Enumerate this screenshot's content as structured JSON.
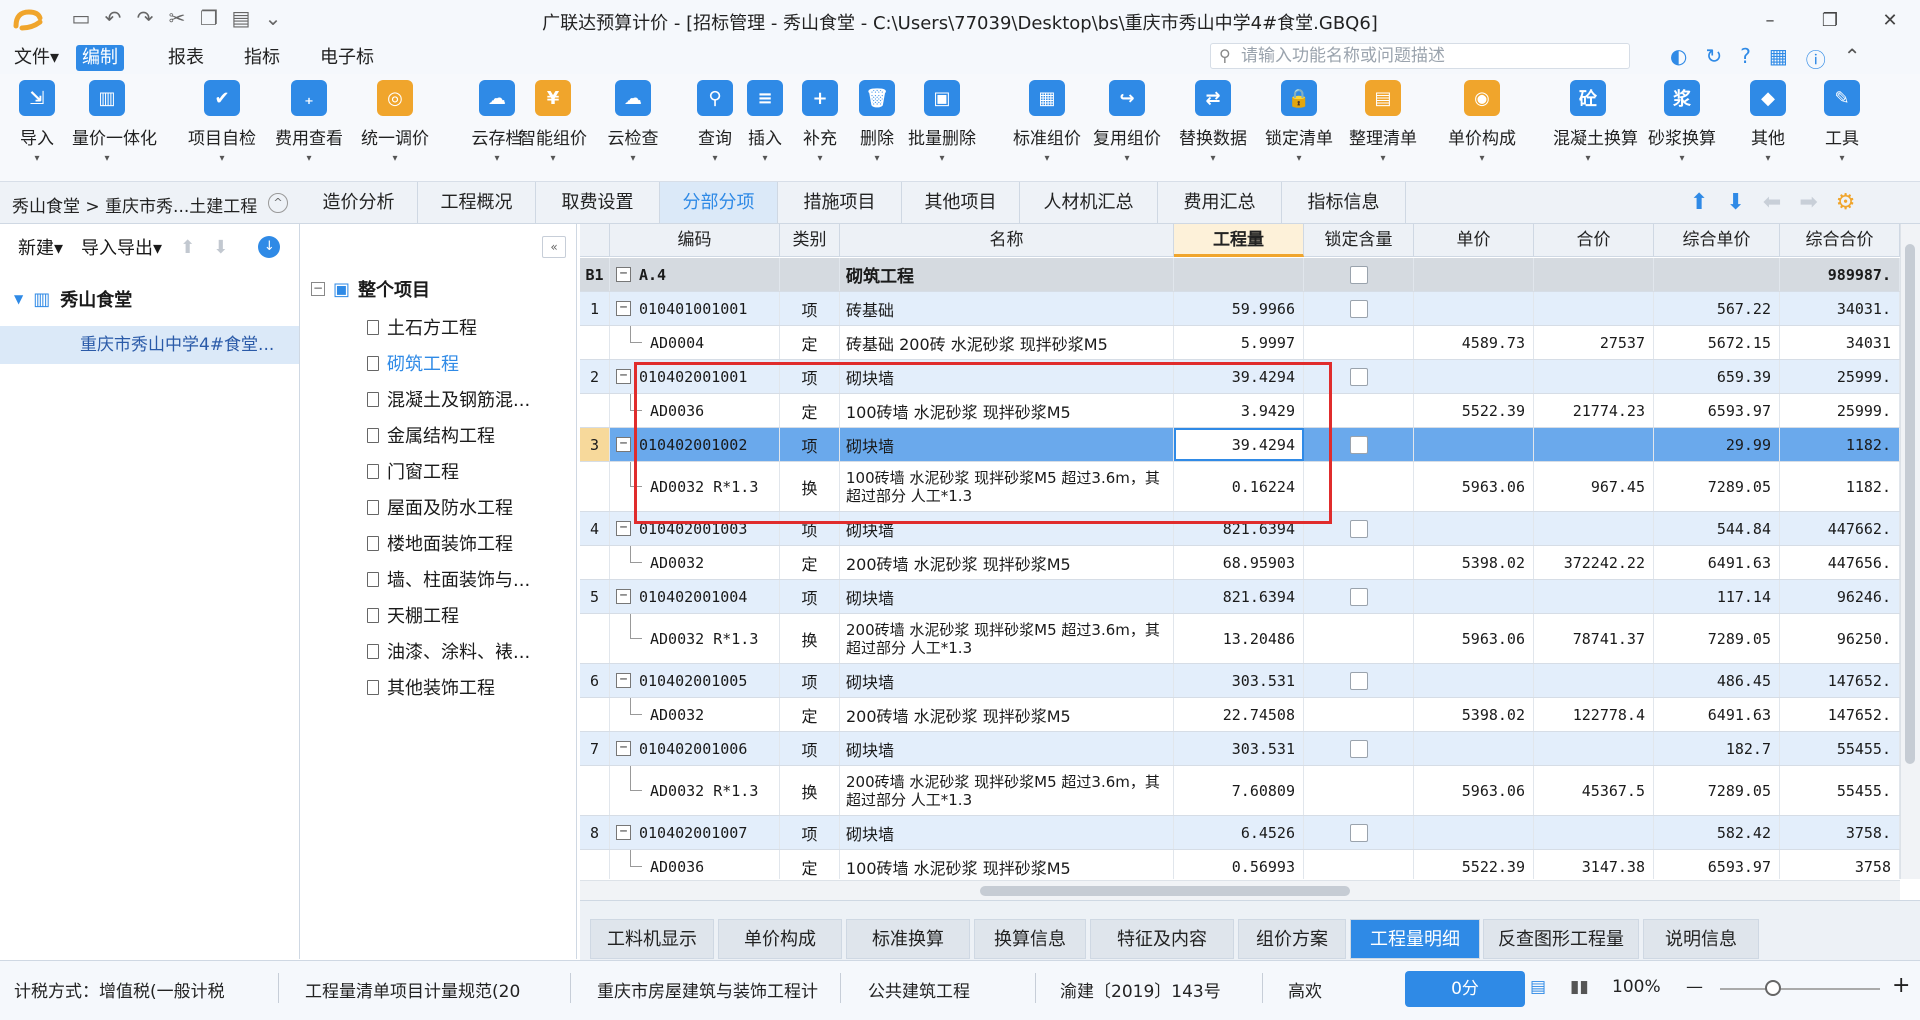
{
  "app": {
    "title": "广联达预算计价 - [招标管理 - 秀山食堂 - C:\\Users\\77039\\Desktop\\bs\\重庆市秀山中学4#食堂.GBQ6]"
  },
  "window_controls": {
    "minimize": "–",
    "restore": "❐",
    "close": "✕"
  },
  "menubar": {
    "items": [
      "文件▾",
      "编制",
      "报表",
      "指标",
      "电子标"
    ],
    "active": "编制",
    "search_placeholder": "请输入功能名称或问题描述"
  },
  "ribbon": {
    "buttons": [
      {
        "label": "导入",
        "icon": "import-icon",
        "color": "#2f8ae6"
      },
      {
        "label": "量价一体化",
        "icon": "price-integration-icon",
        "color": "#2f8ae6"
      },
      {
        "label": "项目自检",
        "icon": "project-check-icon",
        "color": "#2f8ae6"
      },
      {
        "label": "费用查看",
        "icon": "fee-view-icon",
        "color": "#2f8ae6"
      },
      {
        "label": "统一调价",
        "icon": "unified-price-icon",
        "color": "#f0a52c"
      },
      {
        "label": "云存档",
        "icon": "cloud-archive-icon",
        "color": "#2f8ae6"
      },
      {
        "label": "智能组价",
        "icon": "smart-pricing-icon",
        "color": "#f0a52c"
      },
      {
        "label": "云检查",
        "icon": "cloud-check-icon",
        "color": "#2f8ae6"
      },
      {
        "label": "查询",
        "icon": "query-icon",
        "color": "#2f8ae6"
      },
      {
        "label": "插入",
        "icon": "insert-icon",
        "color": "#2f8ae6"
      },
      {
        "label": "补充",
        "icon": "supplement-icon",
        "color": "#2f8ae6"
      },
      {
        "label": "删除",
        "icon": "delete-icon",
        "color": "#2f8ae6"
      },
      {
        "label": "批量删除",
        "icon": "batch-delete-icon",
        "color": "#2f8ae6"
      },
      {
        "label": "标准组价",
        "icon": "standard-pricing-icon",
        "color": "#2f8ae6"
      },
      {
        "label": "复用组价",
        "icon": "reuse-pricing-icon",
        "color": "#2f8ae6"
      },
      {
        "label": "替换数据",
        "icon": "replace-data-icon",
        "color": "#2f8ae6"
      },
      {
        "label": "锁定清单",
        "icon": "lock-list-icon",
        "color": "#2f8ae6"
      },
      {
        "label": "整理清单",
        "icon": "organize-list-icon",
        "color": "#f0a52c"
      },
      {
        "label": "单价构成",
        "icon": "unit-price-icon",
        "color": "#f0a52c"
      },
      {
        "label": "混凝土换算",
        "icon": "concrete-convert-icon",
        "color": "#2f8ae6"
      },
      {
        "label": "砂浆换算",
        "icon": "mortar-convert-icon",
        "color": "#2f8ae6"
      },
      {
        "label": "其他",
        "icon": "other-icon",
        "color": "#2f8ae6"
      },
      {
        "label": "工具",
        "icon": "tools-icon",
        "color": "#2f8ae6"
      }
    ]
  },
  "breadcrumb": {
    "text": "秀山食堂 > 重庆市秀...土建工程"
  },
  "tabs": [
    "造价分析",
    "工程概况",
    "取费设置",
    "分部分项",
    "措施项目",
    "其他项目",
    "人材机汇总",
    "费用汇总",
    "指标信息"
  ],
  "active_tab": "分部分项",
  "left_panel": {
    "new_label": "新建▾",
    "import_export_label": "导入导出▾",
    "root_label": "秀山食堂",
    "child_label": "重庆市秀山中学4#食堂..."
  },
  "tree": {
    "root": "整个项目",
    "items": [
      "土石方工程",
      "砌筑工程",
      "混凝土及钢筋混...",
      "金属结构工程",
      "门窗工程",
      "屋面及防水工程",
      "楼地面装饰工程",
      "墙、柱面装饰与...",
      "天棚工程",
      "油漆、涂料、裱...",
      "其他装饰工程"
    ],
    "selected": "砌筑工程"
  },
  "grid": {
    "headers": [
      "编码",
      "类别",
      "名称",
      "工程量",
      "锁定含量",
      "单价",
      "合价",
      "综合单价",
      "综合合价"
    ],
    "rows": [
      {
        "num": "B1",
        "code": "A.4",
        "type": "",
        "name": "砌筑工程",
        "qty": "",
        "lock": true,
        "price": "",
        "total": "",
        "unit": "",
        "sum": "989987.",
        "kind": "section"
      },
      {
        "num": "1",
        "code": "010401001001",
        "type": "项",
        "name": "砖基础",
        "qty": "59.9966",
        "lock": true,
        "price": "",
        "total": "",
        "unit": "567.22",
        "sum": "34031.",
        "kind": "item"
      },
      {
        "num": "",
        "code": "AD0004",
        "type": "定",
        "name": "砖基础 200砖 水泥砂浆 现拌砂浆M5",
        "qty": "5.9997",
        "lock": false,
        "price": "4589.73",
        "total": "27537",
        "unit": "5672.15",
        "sum": "34031",
        "kind": "sub"
      },
      {
        "num": "2",
        "code": "010402001001",
        "type": "项",
        "name": "砌块墙",
        "qty": "39.4294",
        "lock": true,
        "price": "",
        "total": "",
        "unit": "659.39",
        "sum": "25999.",
        "kind": "item"
      },
      {
        "num": "",
        "code": "AD0036",
        "type": "定",
        "name": "100砖墙 水泥砂浆 现拌砂浆M5",
        "qty": "3.9429",
        "lock": false,
        "price": "5522.39",
        "total": "21774.23",
        "unit": "6593.97",
        "sum": "25999.",
        "kind": "sub"
      },
      {
        "num": "3",
        "code": "010402001002",
        "type": "项",
        "name": "砌块墙",
        "qty": "39.4294",
        "lock": true,
        "price": "",
        "total": "",
        "unit": "29.99",
        "sum": "1182.",
        "kind": "selected"
      },
      {
        "num": "",
        "code": "AD0032 R*1.3",
        "type": "换",
        "name": "100砖墙 水泥砂浆 现拌砂浆M5  超过3.6m，其超过部分 人工*1.3",
        "qty": "0.16224",
        "lock": false,
        "price": "5963.06",
        "total": "967.45",
        "unit": "7289.05",
        "sum": "1182.",
        "kind": "sub2"
      },
      {
        "num": "4",
        "code": "010402001003",
        "type": "项",
        "name": "砌块墙",
        "qty": "821.6394",
        "lock": true,
        "price": "",
        "total": "",
        "unit": "544.84",
        "sum": "447662.",
        "kind": "item"
      },
      {
        "num": "",
        "code": "AD0032",
        "type": "定",
        "name": "200砖墙 水泥砂浆 现拌砂浆M5",
        "qty": "68.95903",
        "lock": false,
        "price": "5398.02",
        "total": "372242.22",
        "unit": "6491.63",
        "sum": "447656.",
        "kind": "sub"
      },
      {
        "num": "5",
        "code": "010402001004",
        "type": "项",
        "name": "砌块墙",
        "qty": "821.6394",
        "lock": true,
        "price": "",
        "total": "",
        "unit": "117.14",
        "sum": "96246.",
        "kind": "item"
      },
      {
        "num": "",
        "code": "AD0032 R*1.3",
        "type": "换",
        "name": "200砖墙 水泥砂浆 现拌砂浆M5  超过3.6m，其超过部分 人工*1.3",
        "qty": "13.20486",
        "lock": false,
        "price": "5963.06",
        "total": "78741.37",
        "unit": "7289.05",
        "sum": "96250.",
        "kind": "sub2"
      },
      {
        "num": "6",
        "code": "010402001005",
        "type": "项",
        "name": "砌块墙",
        "qty": "303.531",
        "lock": true,
        "price": "",
        "total": "",
        "unit": "486.45",
        "sum": "147652.",
        "kind": "item"
      },
      {
        "num": "",
        "code": "AD0032",
        "type": "定",
        "name": "200砖墙 水泥砂浆 现拌砂浆M5",
        "qty": "22.74508",
        "lock": false,
        "price": "5398.02",
        "total": "122778.4",
        "unit": "6491.63",
        "sum": "147652.",
        "kind": "sub"
      },
      {
        "num": "7",
        "code": "010402001006",
        "type": "项",
        "name": "砌块墙",
        "qty": "303.531",
        "lock": true,
        "price": "",
        "total": "",
        "unit": "182.7",
        "sum": "55455.",
        "kind": "item"
      },
      {
        "num": "",
        "code": "AD0032 R*1.3",
        "type": "换",
        "name": "200砖墙 水泥砂浆 现拌砂浆M5  超过3.6m，其超过部分 人工*1.3",
        "qty": "7.60809",
        "lock": false,
        "price": "5963.06",
        "total": "45367.5",
        "unit": "7289.05",
        "sum": "55455.",
        "kind": "sub2"
      },
      {
        "num": "8",
        "code": "010402001007",
        "type": "项",
        "name": "砌块墙",
        "qty": "6.4526",
        "lock": true,
        "price": "",
        "total": "",
        "unit": "582.42",
        "sum": "3758.",
        "kind": "item"
      },
      {
        "num": "",
        "code": "AD0036",
        "type": "定",
        "name": "100砖墙 水泥砂浆 现拌砂浆M5",
        "qty": "0.56993",
        "lock": false,
        "price": "5522.39",
        "total": "3147.38",
        "unit": "6593.97",
        "sum": "3758",
        "kind": "sub"
      }
    ]
  },
  "bottom_tabs": [
    "工料机显示",
    "单价构成",
    "标准换算",
    "换算信息",
    "特征及内容",
    "组价方案",
    "工程量明细",
    "反查图形工程量",
    "说明信息"
  ],
  "bottom_active": "工程量明细",
  "status": {
    "tax": "计税方式：增值税(一般计税",
    "rule": "工程量清单项目计量规范(20",
    "quota": "重庆市房屋建筑与装饰工程计",
    "type": "公共建筑工程",
    "doc": "渝建〔2019〕143号",
    "user": "高欢",
    "score": "0分",
    "zoom": "100%"
  },
  "colors": {
    "accent": "#2f8ae6",
    "highlight_border": "#e02c2c",
    "item_row": "#e3eefb",
    "selected_row": "#6aa9ec"
  }
}
